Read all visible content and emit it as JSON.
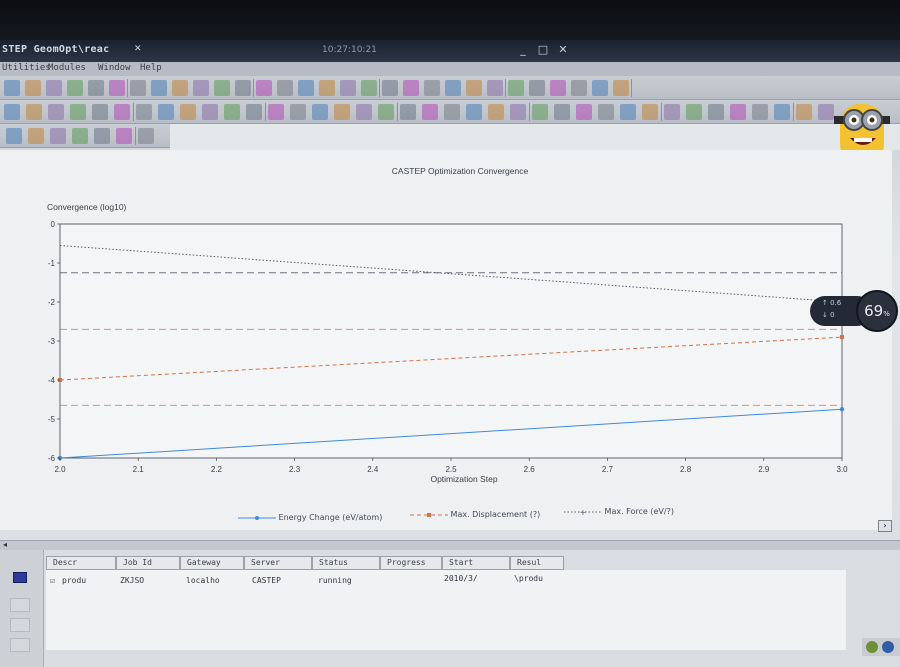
{
  "window": {
    "title": "STEP GeomOpt\\reac",
    "tab_marker": "✕",
    "clock": "10:27:10:21",
    "minimize": "_",
    "maximize": "□",
    "close": "✕"
  },
  "menubar": {
    "items": [
      "Utilities",
      "Modules",
      "Window",
      "Help"
    ]
  },
  "colors": {
    "energy": "#3d8ad6",
    "displacement": "#d0724a",
    "force": "#555b66",
    "accent_toolbar": "#b14ab8"
  },
  "chart_data": {
    "type": "line",
    "title": "CASTEP Optimization Convergence",
    "ylabel": "Convergence (log10)",
    "xlabel": "Optimization Step",
    "xlim": [
      2.0,
      3.0
    ],
    "ylim": [
      -6,
      0
    ],
    "x_ticks": [
      "2.0",
      "2.1",
      "2.2",
      "2.3",
      "2.4",
      "2.5",
      "2.6",
      "2.7",
      "2.8",
      "2.9",
      "3.0"
    ],
    "y_ticks": [
      "0",
      "-1",
      "-2",
      "-3",
      "-4",
      "-5",
      "-6"
    ],
    "series": [
      {
        "name": "Energy Change (eV/atom)",
        "style": "solid",
        "color": "#3d8ad6",
        "x": [
          2.0,
          3.0
        ],
        "y": [
          -6.0,
          -4.75
        ]
      },
      {
        "name": "Max. Displacement (?)",
        "style": "dashed",
        "color": "#d0724a",
        "x": [
          2.0,
          3.0
        ],
        "y": [
          -4.0,
          -2.9
        ]
      },
      {
        "name": "Max. Force (eV/?)",
        "style": "dotted",
        "color": "#555b66",
        "x": [
          2.0,
          3.0
        ],
        "y": [
          -0.55,
          -2.0
        ]
      }
    ],
    "threshold_lines": [
      {
        "y": -1.25,
        "color": "#555b66"
      },
      {
        "y": -2.7,
        "color": "#d0724a"
      },
      {
        "y": -4.65,
        "color": "#d0724a"
      }
    ],
    "grid": false,
    "legend_placement": "bottom"
  },
  "overlay": {
    "percent": "69",
    "percent_unit": "%",
    "upload": "0.6",
    "download": "0"
  },
  "jobs": {
    "columns": [
      "Descr",
      "Job Id",
      "Gateway",
      "Server",
      "Status",
      "Progress",
      "Start",
      "Resul"
    ],
    "row": [
      "produ",
      "ZKJSO",
      "localho",
      "CASTEP",
      "running",
      "",
      "2010/3/",
      "\\produ"
    ]
  }
}
